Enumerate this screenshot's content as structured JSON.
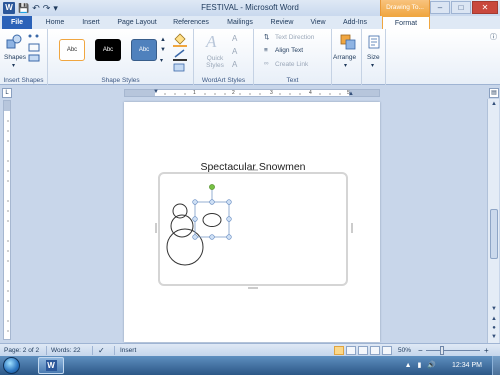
{
  "titlebar": {
    "app_icon": "W",
    "title": "FESTIVAL - Microsoft Word",
    "context_tab": "Drawing To...",
    "qat_icons": [
      "save-icon",
      "undo-icon",
      "redo-icon",
      "customize-qat-icon"
    ],
    "window_buttons": {
      "minimize": "–",
      "maximize": "□",
      "close": "✕"
    }
  },
  "tabs": [
    {
      "label": "File"
    },
    {
      "label": "Home"
    },
    {
      "label": "Insert"
    },
    {
      "label": "Page Layout"
    },
    {
      "label": "References"
    },
    {
      "label": "Mailings"
    },
    {
      "label": "Review"
    },
    {
      "label": "View"
    },
    {
      "label": "Add-Ins"
    },
    {
      "label": "Format"
    }
  ],
  "ribbon": {
    "insert_shapes": {
      "label": "Insert Shapes",
      "shapes_button": "Shapes"
    },
    "shape_styles": {
      "label": "Shape Styles",
      "styles": [
        {
          "label": "Abc",
          "bg": "#ffffff",
          "border": "#f0a640",
          "fg": "#333333"
        },
        {
          "label": "Abc",
          "bg": "#000000",
          "border": "#000000",
          "fg": "#ffffff"
        },
        {
          "label": "Abc",
          "bg": "#4f81bd",
          "border": "#385d8a",
          "fg": "#ffffff"
        }
      ]
    },
    "wordart_styles": {
      "label": "WordArt Styles",
      "quick_styles": "Quick Styles"
    },
    "text": {
      "label": "Text",
      "text_direction": "Text Direction",
      "align_text": "Align Text",
      "create_link": "Create Link"
    },
    "arrange": {
      "label": "Arrange"
    },
    "size": {
      "label": "Size"
    }
  },
  "document": {
    "heading": "Spectacular Snowmen"
  },
  "ruler": {
    "numbers": [
      "1",
      "2",
      "3",
      "4",
      "5"
    ]
  },
  "status": {
    "page": "Page: 2 of 2",
    "words": "Words: 22",
    "mode": "Insert",
    "zoom": "50%",
    "zoom_level": 0.5
  },
  "taskbar": {
    "time": "12:34 PM",
    "word_button": "W"
  },
  "colors": {
    "accent": "#2b579a",
    "context_tab": "#f0a640",
    "selection_handle": "#6f9fd8",
    "rotate_handle": "#76c043"
  }
}
